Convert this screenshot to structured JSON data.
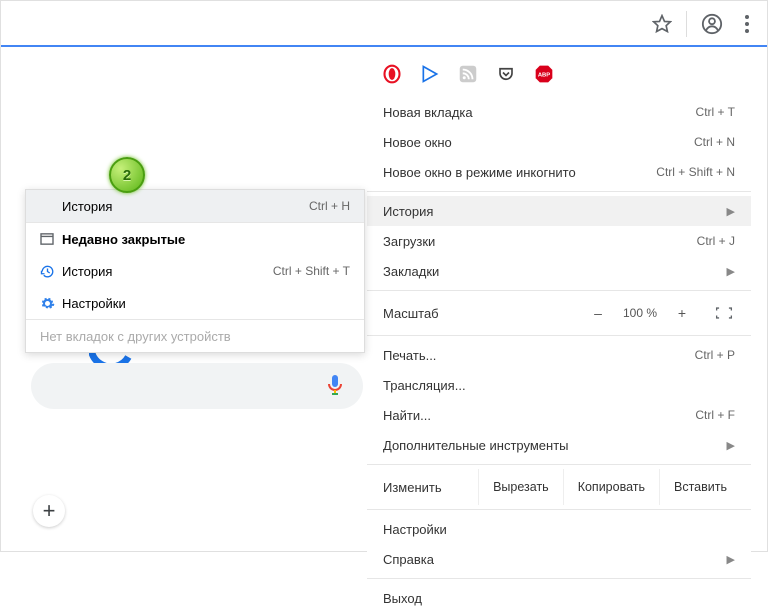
{
  "toolbar": {
    "icons": [
      "star-icon",
      "profile-icon",
      "kebab-icon"
    ]
  },
  "extensions": [
    "opera-icon",
    "play-icon",
    "rss-icon",
    "pocket-icon",
    "abp-icon"
  ],
  "badge": {
    "number": "2"
  },
  "main_menu": {
    "new_tab": {
      "label": "Новая вкладка",
      "shortcut": "Ctrl + T"
    },
    "new_window": {
      "label": "Новое окно",
      "shortcut": "Ctrl + N"
    },
    "incognito": {
      "label": "Новое окно в режиме инкогнито",
      "shortcut": "Ctrl + Shift + N"
    },
    "history": {
      "label": "История"
    },
    "downloads": {
      "label": "Загрузки",
      "shortcut": "Ctrl + J"
    },
    "bookmarks": {
      "label": "Закладки"
    },
    "zoom": {
      "label": "Масштаб",
      "minus": "–",
      "value": "100 %",
      "plus": "+"
    },
    "print": {
      "label": "Печать...",
      "shortcut": "Ctrl + P"
    },
    "cast": {
      "label": "Трансляция..."
    },
    "find": {
      "label": "Найти...",
      "shortcut": "Ctrl + F"
    },
    "more_tools": {
      "label": "Дополнительные инструменты"
    },
    "edit": {
      "label": "Изменить",
      "cut": "Вырезать",
      "copy": "Копировать",
      "paste": "Вставить"
    },
    "settings": {
      "label": "Настройки"
    },
    "help": {
      "label": "Справка"
    },
    "exit": {
      "label": "Выход"
    }
  },
  "sub_menu": {
    "history": {
      "label": "История",
      "shortcut": "Ctrl + H"
    },
    "recently_closed": {
      "label": "Недавно закрытые"
    },
    "history2": {
      "label": "История",
      "shortcut": "Ctrl + Shift + T"
    },
    "settings": {
      "label": "Настройки"
    },
    "no_tabs": {
      "label": "Нет вкладок с других устройств"
    }
  }
}
